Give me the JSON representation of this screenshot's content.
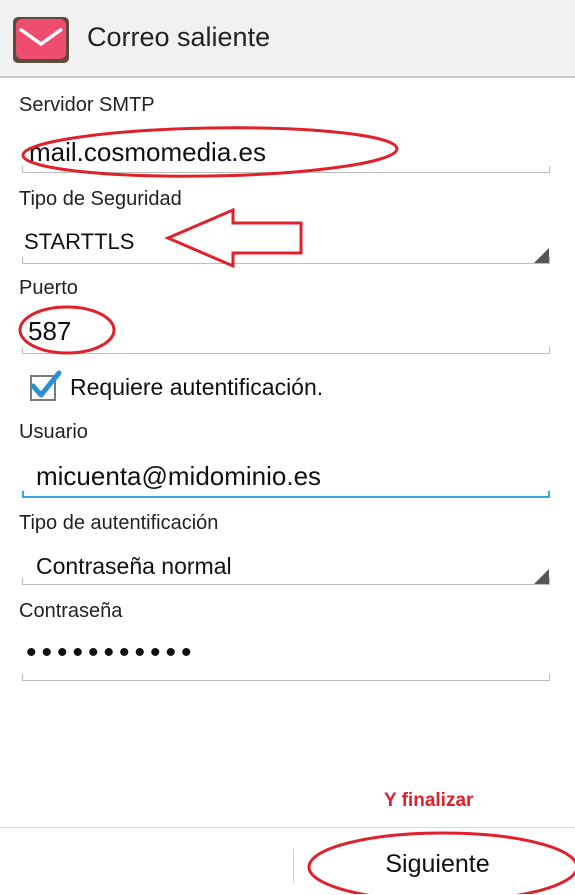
{
  "header": {
    "title": "Correo saliente",
    "icon": "mail-app-icon"
  },
  "form": {
    "smtp_label": "Servidor SMTP",
    "smtp_value": "mail.cosmomedia.es",
    "security_label": "Tipo de Seguridad",
    "security_value": "STARTTLS",
    "port_label": "Puerto",
    "port_value": "587",
    "auth_required_label": "Requiere autentificación.",
    "auth_required_checked": true,
    "user_label": "Usuario",
    "user_value": "micuenta@midominio.es",
    "auth_type_label": "Tipo de autentificación",
    "auth_type_value": "Contraseña normal",
    "password_label": "Contraseña",
    "password_value": "•••••••••••"
  },
  "annotation": {
    "note": "Y finalizar"
  },
  "footer": {
    "next_label": "Siguiente"
  },
  "colors": {
    "accent": "#33a8dd",
    "annotation": "#e0202a",
    "checkbox": "#2b8fd6"
  }
}
